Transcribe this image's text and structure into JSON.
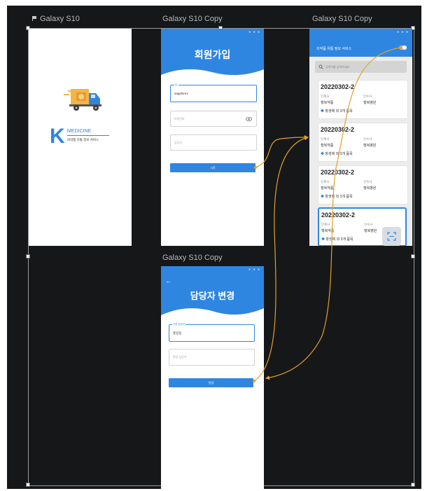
{
  "canvas": {
    "background": "#161718",
    "accent": "#2f86e0",
    "connector_color": "#e3a02c"
  },
  "frames": {
    "splash": {
      "label": "Galaxy S10",
      "brand_letter": "K",
      "brand_name": "MEDICINE",
      "tagline": "의약품 유통 정보 서비스",
      "truck_icon": "delivery-truck-icon"
    },
    "signup": {
      "label": "Galaxy S10 Copy",
      "title": "회원가입",
      "id_label": "ID",
      "id_value": "sapphire1",
      "password_placeholder": "비밀번호",
      "manager_placeholder": "담당자",
      "submit_label": "시작"
    },
    "list": {
      "label": "Galaxy S10 Copy",
      "header_title": "의약품 유통 정보 서비스",
      "search_placeholder": "검색어를 입력하세요",
      "cards": [
        {
          "id": "20220302-2",
          "left_label": "인계사",
          "left_value": "행복약품",
          "right_label": "인수사",
          "right_value": "행복병원",
          "meta": "항생제 외 3개 품목"
        },
        {
          "id": "20220302-2",
          "left_label": "인계사",
          "left_value": "행복약품",
          "right_label": "인수사",
          "right_value": "행복병원",
          "meta": "항생제 외 3개 품목"
        },
        {
          "id": "20220302-2",
          "left_label": "인계사",
          "left_value": "행복약품",
          "right_label": "인수사",
          "right_value": "행복병원",
          "meta": "항생제 외 3개 품목"
        },
        {
          "id": "20220302-2",
          "left_label": "인계사",
          "left_value": "행복약품",
          "right_label": "인수사",
          "right_value": "행복병원",
          "meta": "항생제 외 3개 품목"
        }
      ]
    },
    "change_manager": {
      "label": "Galaxy S10 Copy",
      "back": "←",
      "title": "담당자 변경",
      "current_label": "기존 담당자",
      "current_value": "홍길동",
      "new_placeholder": "변경 담당자",
      "submit_label": "변경"
    }
  }
}
